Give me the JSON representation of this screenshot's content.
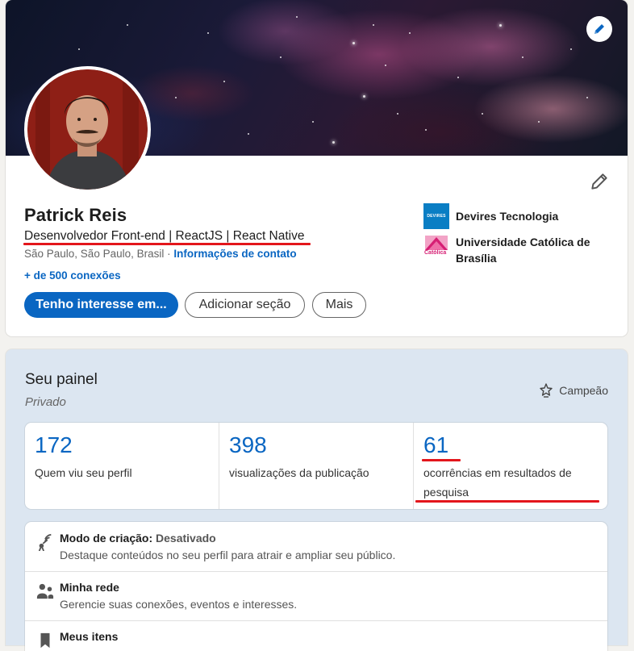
{
  "profile": {
    "name": "Patrick Reis",
    "headline": "Desenvolvedor Front-end | ReactJS | React Native",
    "location": "São Paulo, São Paulo, Brasil",
    "separator": " · ",
    "contact_info_label": "Informações de contato",
    "connections_label": "+ de 500 conexões",
    "buttons": {
      "open_to": "Tenho interesse em...",
      "add_section": "Adicionar seção",
      "more": "Mais"
    },
    "companies": [
      {
        "name": "Devires Tecnologia",
        "logo_text": "DEVIRES",
        "logo_color": "#0a7ec4"
      },
      {
        "name": "Universidade Católica de Brasília",
        "logo_text": "Católica",
        "logo_color": "#d61e74"
      }
    ],
    "icons": [
      "pencil-icon",
      "edit-icon"
    ]
  },
  "dashboard": {
    "title": "Seu painel",
    "subtitle": "Privado",
    "badge_label": "Campeão",
    "badge_icon": "star-icon",
    "stats": [
      {
        "value": "172",
        "label": "Quem viu seu perfil"
      },
      {
        "value": "398",
        "label": "visualizações da publicação"
      },
      {
        "value": "61",
        "label": "ocorrências em resultados de pesquisa"
      }
    ],
    "tools": [
      {
        "title": "Modo de criação:",
        "status": "Desativado",
        "description": "Destaque conteúdos no seu perfil para atrair e ampliar seu público.",
        "icon": "broadcast-icon"
      },
      {
        "title": "Minha rede",
        "description": "Gerencie suas conexões, eventos e interesses.",
        "icon": "people-icon"
      },
      {
        "title": "Meus itens",
        "icon": "bookmark-icon"
      }
    ]
  },
  "colors": {
    "accent": "#0a66c2",
    "highlight_underline": "#e3161c",
    "dashboard_bg": "#dce6f1"
  }
}
